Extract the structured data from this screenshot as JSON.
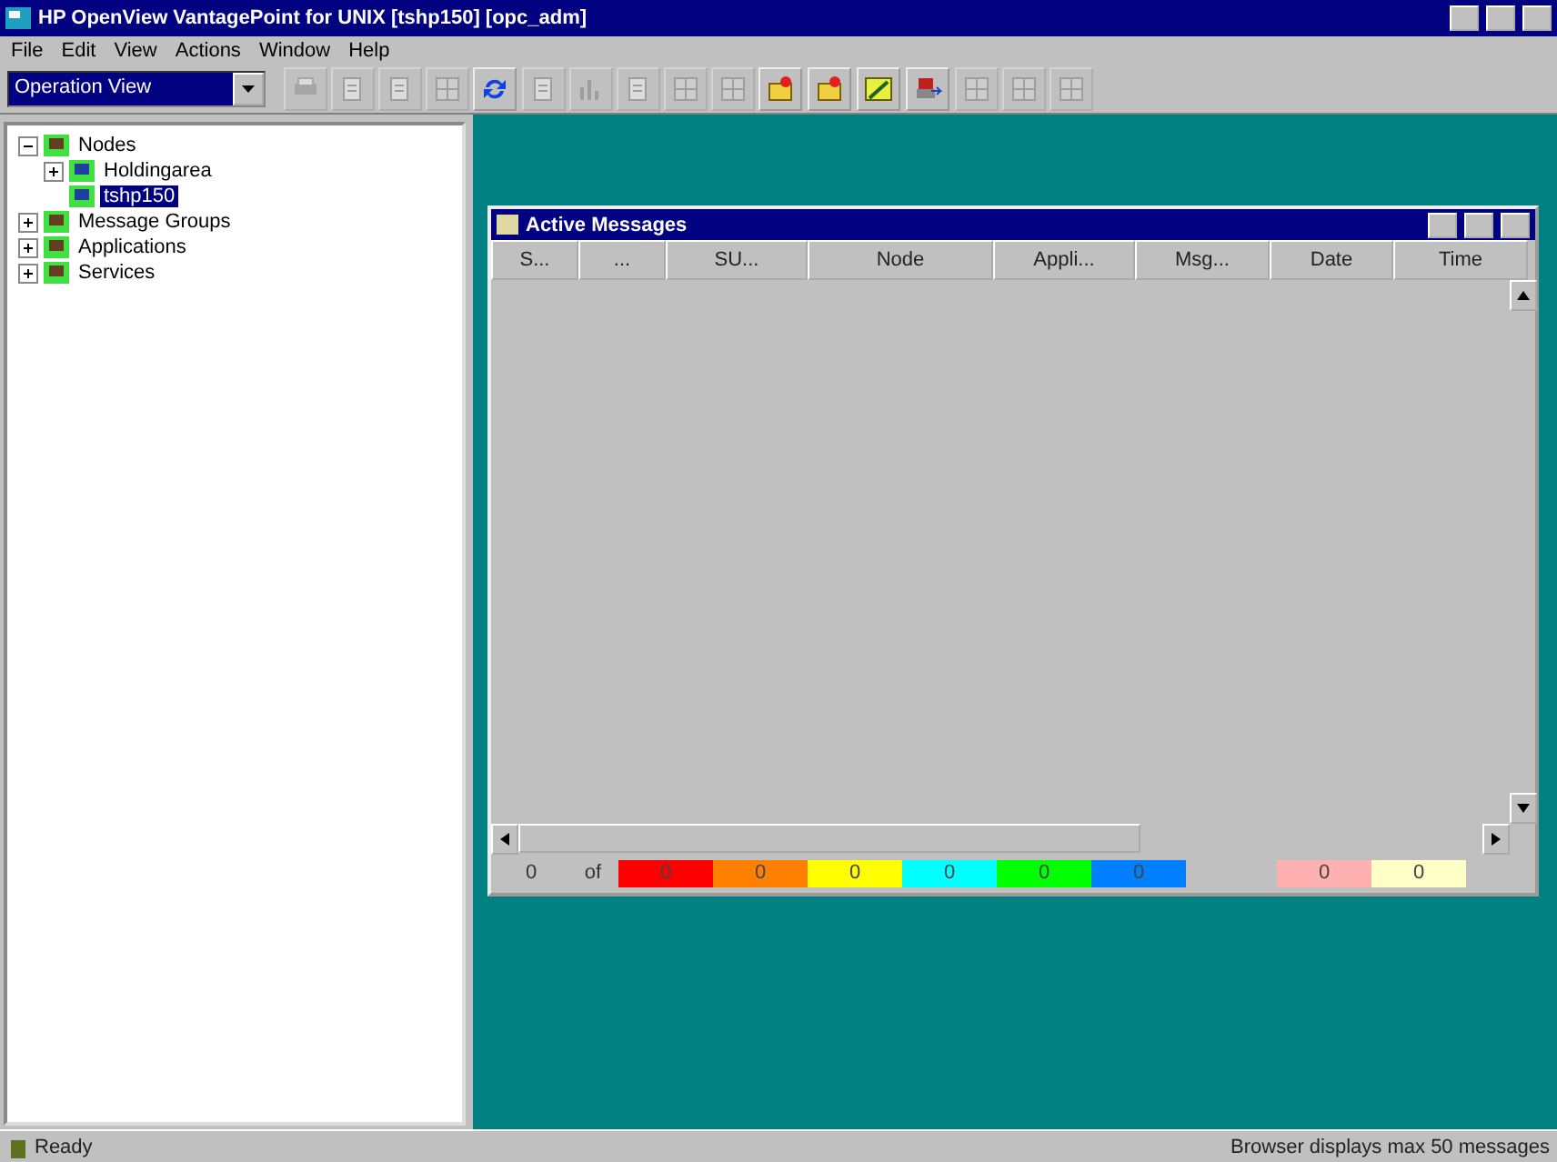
{
  "window": {
    "title": "HP OpenView VantagePoint for UNIX  [tshp150] [opc_adm]"
  },
  "menu": [
    "File",
    "Edit",
    "View",
    "Actions",
    "Window",
    "Help"
  ],
  "view_select": {
    "value": "Operation View"
  },
  "toolbar": [
    {
      "disabled": true
    },
    {
      "disabled": true
    },
    {
      "disabled": true
    },
    {
      "disabled": true
    },
    {
      "disabled": false
    },
    {
      "disabled": true
    },
    {
      "disabled": true
    },
    {
      "disabled": true
    },
    {
      "disabled": true
    },
    {
      "disabled": true
    },
    {
      "disabled": false
    },
    {
      "disabled": false
    },
    {
      "disabled": false
    },
    {
      "disabled": false
    },
    {
      "disabled": true
    },
    {
      "disabled": true
    },
    {
      "disabled": true
    }
  ],
  "tree": [
    {
      "label": "Nodes",
      "expanded": true,
      "selected": false,
      "children": [
        {
          "label": "Holdingarea",
          "expanded": false,
          "selected": false
        },
        {
          "label": "tshp150",
          "selected": true
        }
      ]
    },
    {
      "label": "Message Groups",
      "expanded": false,
      "selected": false
    },
    {
      "label": "Applications",
      "expanded": false,
      "selected": false
    },
    {
      "label": "Services",
      "expanded": false,
      "selected": false
    }
  ],
  "messages_window": {
    "title": "Active Messages",
    "columns": [
      "S...",
      "...",
      "SU...",
      "Node",
      "Appli...",
      "Msg...",
      "Date",
      "Time"
    ],
    "summary": {
      "count": "0",
      "of": "of",
      "severity_counts": [
        {
          "value": "0",
          "color": "#ff0000"
        },
        {
          "value": "0",
          "color": "#ff8000"
        },
        {
          "value": "0",
          "color": "#ffff00"
        },
        {
          "value": "0",
          "color": "#00ffff"
        },
        {
          "value": "0",
          "color": "#00ff00"
        },
        {
          "value": "0",
          "color": "#0080ff"
        }
      ],
      "extra_counts": [
        {
          "value": "0",
          "color": "#ffb0b0"
        },
        {
          "value": "0",
          "color": "#ffffc8"
        }
      ]
    }
  },
  "status_bar": {
    "left": "Ready",
    "right": "Browser displays max 50 messages"
  }
}
